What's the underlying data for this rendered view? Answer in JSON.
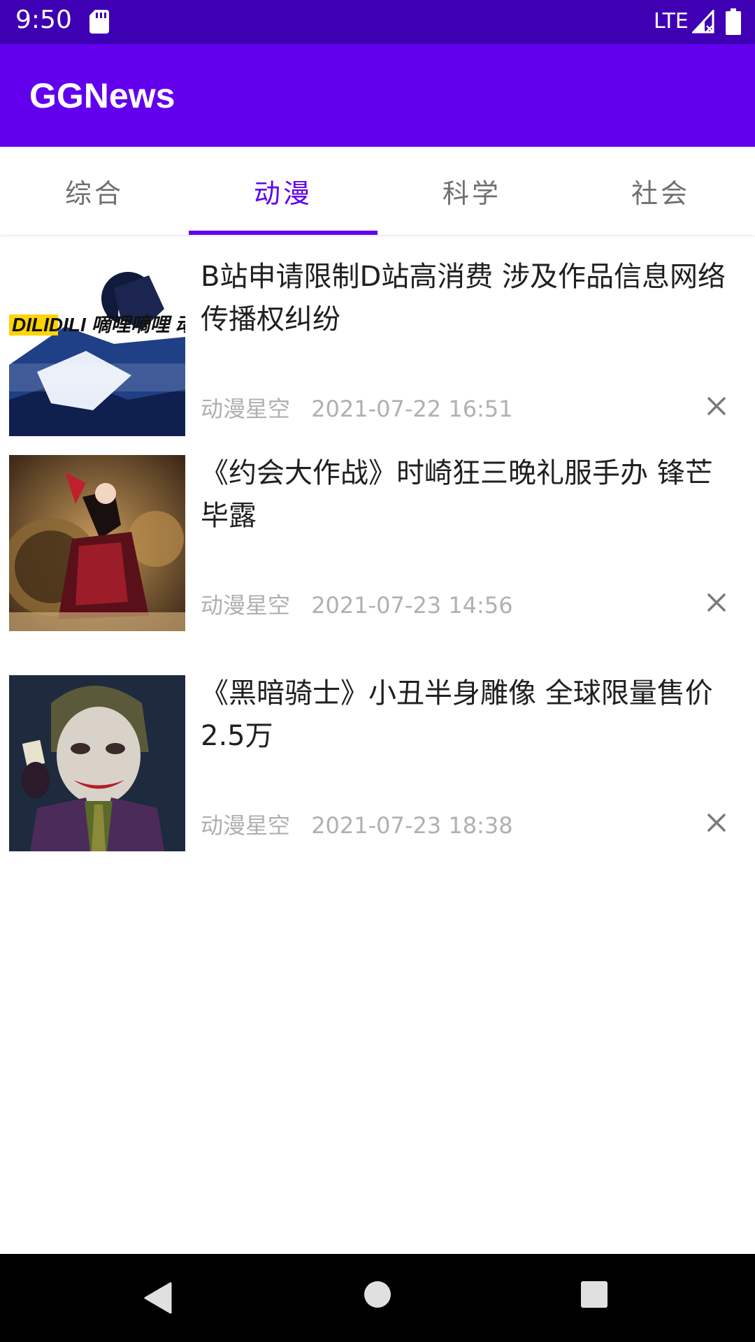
{
  "status_bar": {
    "time": "9:50",
    "network": "LTE",
    "icons": [
      "sd-card-icon",
      "signal-icon",
      "battery-icon"
    ]
  },
  "app_bar": {
    "title": "GGNews",
    "color": "#6200ee"
  },
  "tabs": [
    {
      "label": "综合",
      "active": false
    },
    {
      "label": "动漫",
      "active": true
    },
    {
      "label": "科学",
      "active": false
    },
    {
      "label": "社会",
      "active": false
    }
  ],
  "news": [
    {
      "title": "B站申请限制D站高消费 涉及作品信息网络传播权纠纷",
      "source": "动漫星空",
      "time": "2021-07-22 16:51",
      "thumbnail_text": "DILIDILI 嘀哩嘀哩 动漫",
      "close_icon": "close-icon"
    },
    {
      "title": "《约会大作战》时崎狂三晚礼服手办 锋芒毕露",
      "source": "动漫星空",
      "time": "2021-07-23 14:56",
      "close_icon": "close-icon"
    },
    {
      "title": "《黑暗骑士》小丑半身雕像 全球限量售价2.5万",
      "source": "动漫星空",
      "time": "2021-07-23 18:38",
      "close_icon": "close-icon"
    }
  ],
  "nav_bar": {
    "icons": [
      "back-icon",
      "home-icon",
      "recents-icon"
    ]
  }
}
